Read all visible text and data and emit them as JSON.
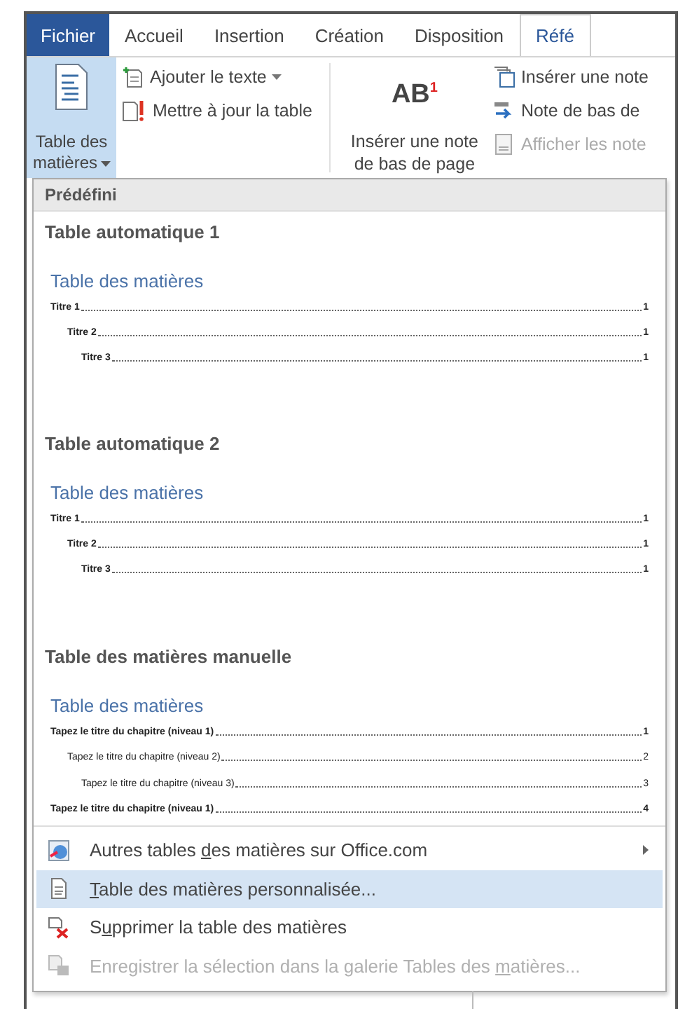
{
  "tabs": [
    {
      "label": "Fichier",
      "kind": "file",
      "selected": false
    },
    {
      "label": "Accueil",
      "kind": "tab",
      "selected": false
    },
    {
      "label": "Insertion",
      "kind": "tab",
      "selected": false
    },
    {
      "label": "Création",
      "kind": "tab",
      "selected": false
    },
    {
      "label": "Disposition",
      "kind": "tab",
      "selected": false
    },
    {
      "label": "Réfé",
      "kind": "tab",
      "selected": true
    }
  ],
  "ribbon": {
    "toc_button": {
      "label": "Table des matières",
      "selected": true,
      "dropdown": true
    },
    "toc_small": [
      {
        "label": "Ajouter le texte",
        "dropdown": true,
        "disabled": false
      },
      {
        "label": "Mettre à jour la table",
        "dropdown": false,
        "disabled": false
      }
    ],
    "footnote_button": {
      "label": "Insérer une note de bas de page",
      "icon_text": "AB",
      "icon_sup": "1"
    },
    "notes_small": [
      {
        "label": "Insérer une note",
        "disabled": false
      },
      {
        "label": "Note de bas de",
        "disabled": false
      },
      {
        "label": "Afficher les note",
        "disabled": true
      }
    ]
  },
  "dropdown": {
    "header": "Prédéfini",
    "sections": [
      {
        "title": "Table automatique 1",
        "preview_title": "Table des matières",
        "kind": "auto",
        "entries": [
          {
            "text": "Titre 1",
            "page": "1",
            "children": [
              {
                "text": "Titre 2",
                "page": "1",
                "children": [
                  {
                    "text": "Titre 3",
                    "page": "1"
                  }
                ]
              }
            ]
          }
        ]
      },
      {
        "title": "Table automatique 2",
        "preview_title": "Table des matières",
        "kind": "auto",
        "entries": [
          {
            "text": "Titre 1",
            "page": "1",
            "children": [
              {
                "text": "Titre 2",
                "page": "1",
                "children": [
                  {
                    "text": "Titre 3",
                    "page": "1"
                  }
                ]
              }
            ]
          }
        ]
      },
      {
        "title": "Table des matières manuelle",
        "preview_title": "Table des matières",
        "kind": "manual",
        "entries": [
          {
            "text": "Tapez le titre du chapitre (niveau 1)",
            "page": "1",
            "children": [
              {
                "text": "Tapez le titre du chapitre (niveau 2)",
                "page": "2",
                "children": [
                  {
                    "text": "Tapez le titre du chapitre (niveau 3)",
                    "page": "3"
                  }
                ]
              }
            ]
          },
          {
            "text": "Tapez le titre du chapitre (niveau 1)",
            "page": "4"
          }
        ]
      }
    ],
    "commands": [
      {
        "before": "Autres tables ",
        "key": "d",
        "after": "es matières sur Office.com",
        "submenu": true,
        "selected": false,
        "disabled": false
      },
      {
        "key": "T",
        "after": "able des matières personnalisée...",
        "submenu": false,
        "selected": true,
        "disabled": false
      },
      {
        "before": "S",
        "key": "u",
        "after": "pprimer la table des matières",
        "submenu": false,
        "selected": false,
        "disabled": false
      },
      {
        "before": "Enregistrer la sélection dans la galerie Tables des ",
        "key": "m",
        "after": "atières...",
        "submenu": false,
        "selected": false,
        "disabled": true
      }
    ]
  }
}
